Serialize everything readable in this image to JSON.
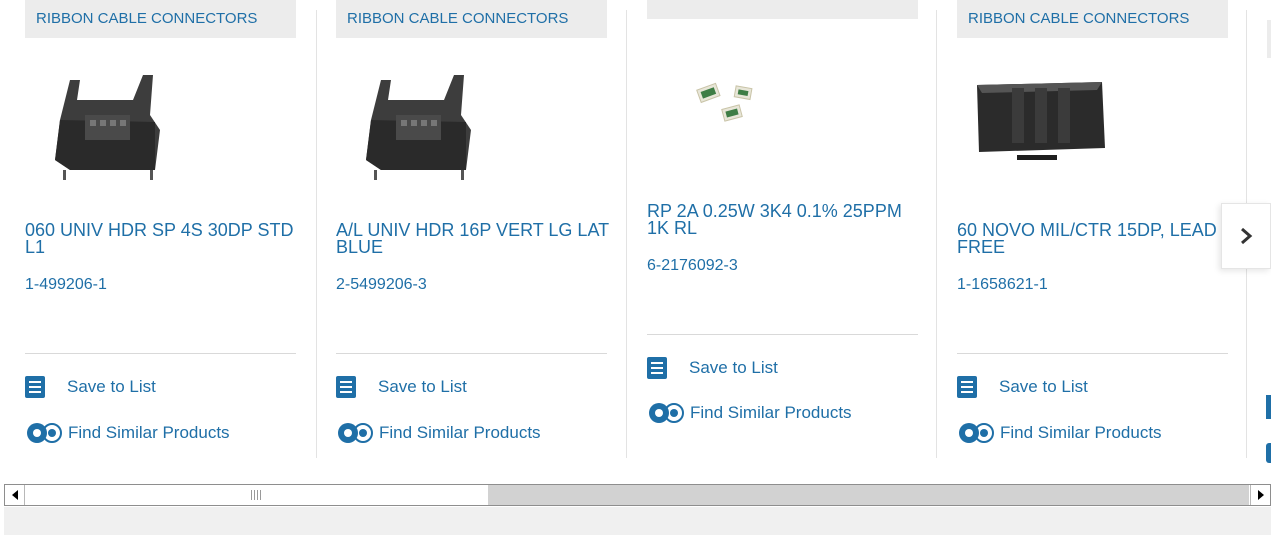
{
  "cards": [
    {
      "category": "RIBBON CABLE CONNECTORS",
      "title": "060 UNIV HDR SP 4S 30DP STD L1",
      "part_number": "1-499206-1",
      "save_label": "Save to List",
      "find_label": "Find Similar Products",
      "image": "ribbon-header-connector"
    },
    {
      "category": "RIBBON CABLE CONNECTORS",
      "title": "A/L UNIV HDR 16P VERT LG LAT BLUE",
      "part_number": "2-5499206-3",
      "save_label": "Save to List",
      "find_label": "Find Similar Products",
      "image": "ribbon-header-connector"
    },
    {
      "category": "",
      "title": "RP 2A 0.25W 3K4 0.1% 25PPM 1K RL",
      "part_number": "6-2176092-3",
      "save_label": "Save to List",
      "find_label": "Find Similar Products",
      "image": "chip-resistors"
    },
    {
      "category": "RIBBON CABLE CONNECTORS",
      "title": "60 NOVO MIL/CTR 15DP, LEAD FREE",
      "part_number": "1-1658621-1",
      "save_label": "Save to List",
      "find_label": "Find Similar Products",
      "image": "black-housing-connector"
    }
  ],
  "carousel": {
    "next_icon": "chevron-right-icon"
  },
  "scrollbar": {
    "left_icon": "arrow-left-icon",
    "right_icon": "arrow-right-icon"
  },
  "colors": {
    "link": "#1f6fa7",
    "category_bg": "#ececec"
  }
}
